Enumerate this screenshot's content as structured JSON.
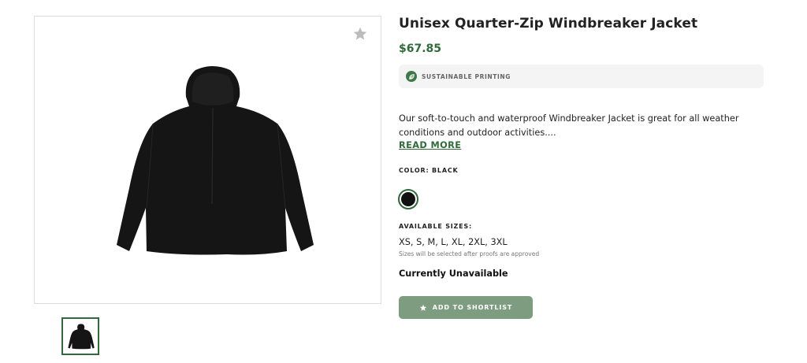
{
  "product": {
    "title": "Unisex Quarter-Zip Windbreaker Jacket",
    "price": "$67.85",
    "badge": {
      "label": "SUSTAINABLE PRINTING",
      "icon": "leaf-icon"
    },
    "description": "Our soft-to-touch and waterproof Windbreaker Jacket is great for all weather conditions and outdoor activities....",
    "read_more": "READ MORE",
    "color": {
      "label": "COLOR: BLACK",
      "swatches": [
        {
          "name": "Black",
          "hex": "#111111",
          "selected": true
        }
      ]
    },
    "sizes": {
      "label": "AVAILABLE SIZES:",
      "value": "XS, S, M, L, XL, 2XL, 3XL",
      "note": "Sizes will be selected after proofs are approved"
    },
    "availability": "Currently Unavailable",
    "shortlist_button": {
      "label": "ADD TO SHORTLIST",
      "icon": "star-icon"
    },
    "favorite_icon": "star-icon",
    "thumbnails": [
      {
        "alt": "black jacket thumbnail",
        "selected": true
      }
    ]
  },
  "colors": {
    "accent": "#2f6b3a",
    "button": "#7e9c7f",
    "badge_bg": "#f4f4f4"
  }
}
